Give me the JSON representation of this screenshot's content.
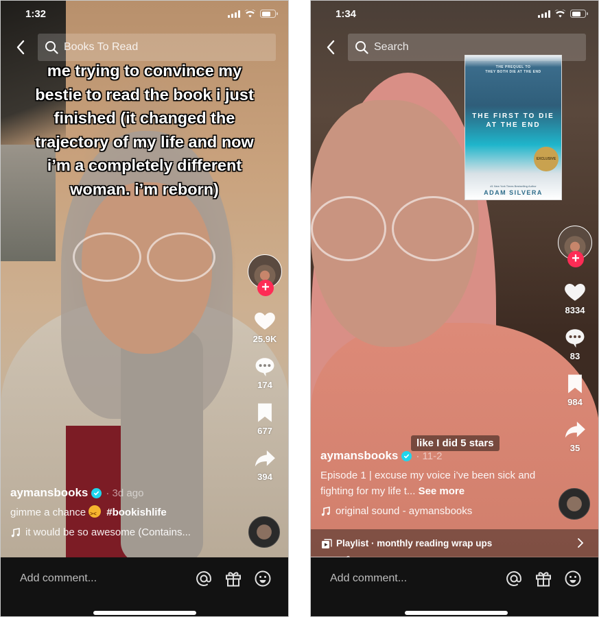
{
  "screens": [
    {
      "status": {
        "time": "1:32"
      },
      "search": {
        "value": "Books To Read",
        "placeholder": "Search"
      },
      "overlay_text": [
        "me trying to convince my",
        "bestie to read the book i just",
        "finished (it changed the",
        "trajectory of my life and now",
        "i’m a completely different",
        "woman. i’m reborn)"
      ],
      "actions": {
        "likes": "25.9K",
        "comments": "174",
        "saves": "677",
        "shares": "394"
      },
      "author": {
        "username": "aymansbooks",
        "date": "· 3d ago",
        "verified": true
      },
      "caption": {
        "text": "gimme a chance",
        "emoji": "confounded-face",
        "hashtag": "#bookishlife"
      },
      "sound": "it would be so awesome (Contains...",
      "bottom": {
        "comment_placeholder": "Add comment..."
      }
    },
    {
      "status": {
        "time": "1:34"
      },
      "search": {
        "value": "",
        "placeholder": "Search"
      },
      "book_cover": {
        "subtitle_line1": "THE PREQUEL TO",
        "subtitle_line2": "THEY BOTH DIE AT THE END",
        "title_line1": "THE FIRST TO DIE",
        "title_line2": "AT THE END",
        "badge": "EXCLUSIVE",
        "author_note": "#1 New York Times Bestselling Author",
        "author": "ADAM SILVERA"
      },
      "sticker_text": "like I did 5 stars",
      "actions": {
        "likes": "8334",
        "comments": "83",
        "saves": "984",
        "shares": "35"
      },
      "author": {
        "username": "aymansbooks",
        "date": "· 11-2",
        "verified": true
      },
      "caption": {
        "text": "Episode 1 | excuse my voice i’ve been sick and fighting for my life t...",
        "see_more": "See more"
      },
      "sound": "original sound - aymansbooks",
      "playlist": {
        "label": "Playlist · monthly reading wrap ups"
      },
      "playback_progress": 0.13,
      "bottom": {
        "comment_placeholder": "Add comment..."
      }
    }
  ],
  "colors": {
    "follow": "#fe2c55",
    "verified": "#20d5ec",
    "bottom_bar": "#121212"
  }
}
